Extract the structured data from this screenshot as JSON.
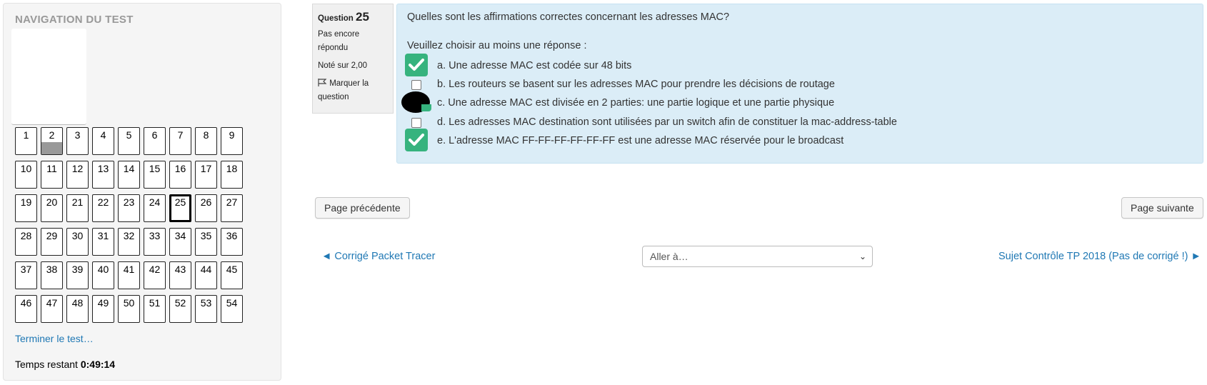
{
  "nav": {
    "title": "NAVIGATION DU TEST",
    "questions": [
      {
        "n": "1",
        "state": "empty"
      },
      {
        "n": "2",
        "state": "answered"
      },
      {
        "n": "3",
        "state": "empty"
      },
      {
        "n": "4",
        "state": "empty"
      },
      {
        "n": "5",
        "state": "empty"
      },
      {
        "n": "6",
        "state": "empty"
      },
      {
        "n": "7",
        "state": "empty"
      },
      {
        "n": "8",
        "state": "empty"
      },
      {
        "n": "9",
        "state": "empty"
      },
      {
        "n": "10",
        "state": "empty"
      },
      {
        "n": "11",
        "state": "empty"
      },
      {
        "n": "12",
        "state": "empty"
      },
      {
        "n": "13",
        "state": "empty"
      },
      {
        "n": "14",
        "state": "empty"
      },
      {
        "n": "15",
        "state": "empty"
      },
      {
        "n": "16",
        "state": "empty"
      },
      {
        "n": "17",
        "state": "empty"
      },
      {
        "n": "18",
        "state": "empty"
      },
      {
        "n": "19",
        "state": "empty"
      },
      {
        "n": "20",
        "state": "empty"
      },
      {
        "n": "21",
        "state": "empty"
      },
      {
        "n": "22",
        "state": "empty"
      },
      {
        "n": "23",
        "state": "empty"
      },
      {
        "n": "24",
        "state": "empty"
      },
      {
        "n": "25",
        "state": "current"
      },
      {
        "n": "26",
        "state": "empty"
      },
      {
        "n": "27",
        "state": "empty"
      },
      {
        "n": "28",
        "state": "empty"
      },
      {
        "n": "29",
        "state": "empty"
      },
      {
        "n": "30",
        "state": "empty"
      },
      {
        "n": "31",
        "state": "empty"
      },
      {
        "n": "32",
        "state": "empty"
      },
      {
        "n": "33",
        "state": "empty"
      },
      {
        "n": "34",
        "state": "empty"
      },
      {
        "n": "35",
        "state": "empty"
      },
      {
        "n": "36",
        "state": "empty"
      },
      {
        "n": "37",
        "state": "empty"
      },
      {
        "n": "38",
        "state": "empty"
      },
      {
        "n": "39",
        "state": "empty"
      },
      {
        "n": "40",
        "state": "empty"
      },
      {
        "n": "41",
        "state": "empty"
      },
      {
        "n": "42",
        "state": "empty"
      },
      {
        "n": "43",
        "state": "empty"
      },
      {
        "n": "44",
        "state": "empty"
      },
      {
        "n": "45",
        "state": "empty"
      },
      {
        "n": "46",
        "state": "empty"
      },
      {
        "n": "47",
        "state": "empty"
      },
      {
        "n": "48",
        "state": "empty"
      },
      {
        "n": "49",
        "state": "empty"
      },
      {
        "n": "50",
        "state": "empty"
      },
      {
        "n": "51",
        "state": "empty"
      },
      {
        "n": "52",
        "state": "empty"
      },
      {
        "n": "53",
        "state": "empty"
      },
      {
        "n": "54",
        "state": "empty"
      }
    ],
    "finish_label": "Terminer le test…",
    "timer_label": "Temps restant",
    "timer_value": "0:49:14"
  },
  "info": {
    "question_label": "Question",
    "question_number": "25",
    "state": "Pas encore répondu",
    "grade": "Noté sur 2,00",
    "flag_label": "Marquer la question",
    "flag_icon": "flag-icon"
  },
  "question": {
    "text": "Quelles sont les affirmations correctes concernant les adresses MAC?",
    "prompt": "Veuillez choisir au moins une réponse :",
    "answers": [
      {
        "label": "a. Une adresse MAC est codée sur 48 bits",
        "marker": "tick"
      },
      {
        "label": "b. Les routeurs se basent sur les adresses MAC pour prendre les décisions de routage",
        "marker": "checkbox"
      },
      {
        "label": "c. Une adresse MAC est divisée en 2 parties: une partie logique et une partie physique",
        "marker": "redacted"
      },
      {
        "label": "d. Les adresses MAC destination sont utilisées par un switch afin de constituer la mac-address-table",
        "marker": "checkbox"
      },
      {
        "label": "e. L'adresse MAC FF-FF-FF-FF-FF-FF est une adresse MAC réservée pour le broadcast",
        "marker": "tick"
      }
    ],
    "colors": {
      "tick": "#36b37e",
      "box_bg": "#dbedf7",
      "link": "#1f78b4"
    }
  },
  "pager": {
    "prev_label": "Page précédente",
    "next_label": "Page suivante"
  },
  "activity_nav": {
    "prev_link": "◄ Corrigé Packet Tracer",
    "jump_placeholder": "Aller à…",
    "next_link": "Sujet Contrôle TP 2018 (Pas de corrigé !) ►"
  }
}
